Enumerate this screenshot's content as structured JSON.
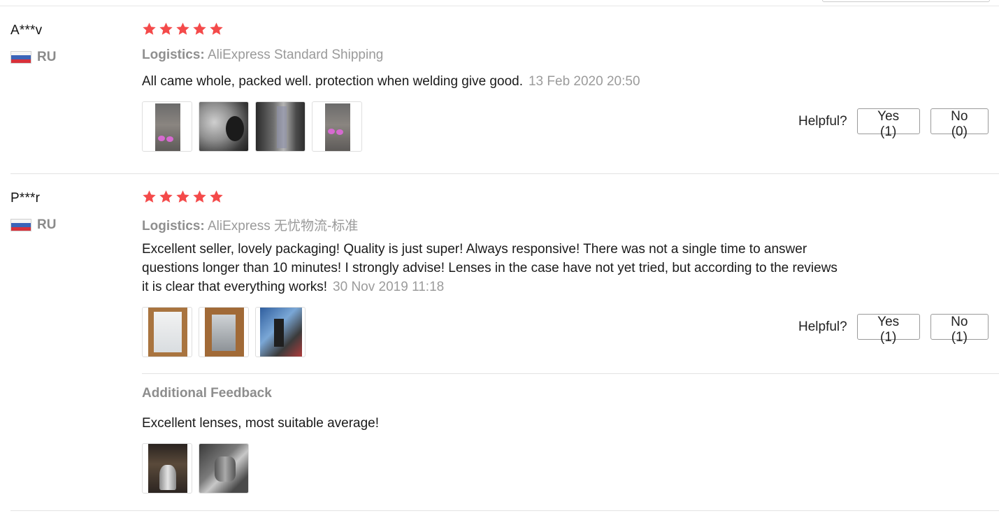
{
  "reviews": [
    {
      "user": "A***v",
      "country": "RU",
      "rating": 5,
      "logistics_label": "Logistics:",
      "logistics_value": "AliExpress Standard Shipping",
      "text": "All came whole, packed well. protection when welding give good.",
      "date": "13 Feb 2020 20:50",
      "photo_count": 4,
      "helpful_label": "Helpful?",
      "yes_label": "Yes (1)",
      "no_label": "No (0)"
    },
    {
      "user": "P***r",
      "country": "RU",
      "rating": 5,
      "logistics_label": "Logistics:",
      "logistics_value": "AliExpress 无忧物流-标准",
      "text_line1": "Excellent seller, lovely packaging! Quality is just super! Always responsive! There was not a single time to answer",
      "text_line2": "questions longer than 10 minutes! I strongly advise! Lenses in the case have not yet tried, but according to the reviews",
      "text_line3": "it is clear that everything works!",
      "date": "30 Nov 2019 11:18",
      "photo_count": 3,
      "helpful_label": "Helpful?",
      "yes_label": "Yes (1)",
      "no_label": "No (1)",
      "additional": {
        "heading": "Additional Feedback",
        "text": "Excellent lenses, most suitable average!",
        "photo_count": 2
      }
    }
  ],
  "colors": {
    "star": "#f44a4a",
    "muted_text": "#9b9b9b",
    "flag_white": "#f4f4f4",
    "flag_blue": "#3a63b8",
    "flag_red": "#d8303a"
  }
}
